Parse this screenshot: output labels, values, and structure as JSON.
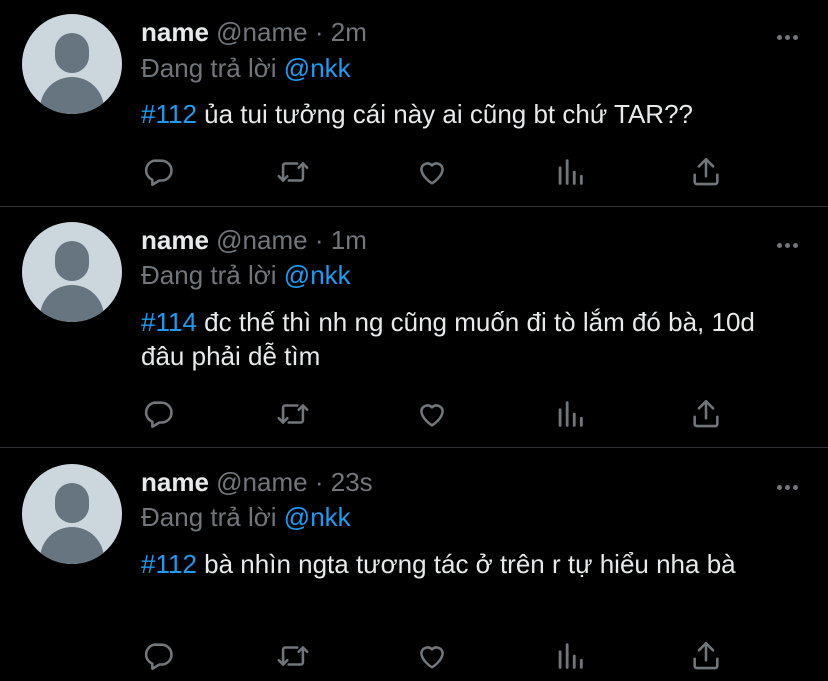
{
  "tweets": [
    {
      "name": "name",
      "handle": "@name",
      "separator": "·",
      "time": "2m",
      "reply_prefix": "Đang trả lời",
      "reply_handle": "@nkk",
      "hashtag": "#112",
      "text": "ủa tui tưởng cái này ai cũng bt chứ TAR??"
    },
    {
      "name": "name",
      "handle": "@name",
      "separator": "·",
      "time": "1m",
      "reply_prefix": "Đang trả lời",
      "reply_handle": "@nkk",
      "hashtag": "#114",
      "text": "đc thế thì nh ng cũng muốn đi tò lắm đó bà, 10d đâu phải dễ tìm"
    },
    {
      "name": "name",
      "handle": "@name",
      "separator": "·",
      "time": "23s",
      "reply_prefix": "Đang trả lời",
      "reply_handle": "@nkk",
      "hashtag": "#112",
      "text": "bà nhìn ngta tương tác ở trên r tự hiểu nha bà"
    }
  ],
  "icons": {
    "reply": "reply-icon",
    "retweet": "retweet-icon",
    "like": "heart-icon",
    "analytics": "analytics-icon",
    "share": "share-icon",
    "more": "more-icon"
  },
  "colors": {
    "background": "#000000",
    "text": "#e7e9ea",
    "muted": "#71767b",
    "link": "#1d9bf0",
    "divider": "#2f3336"
  }
}
